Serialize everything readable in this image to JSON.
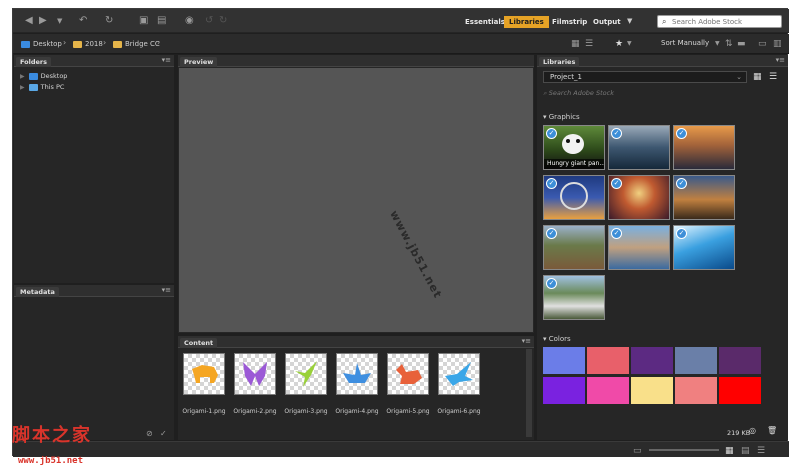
{
  "toolbar": {
    "workspaces": [
      "Essentials",
      "Libraries",
      "Filmstrip",
      "Output"
    ],
    "active_workspace": "Libraries",
    "search_placeholder": "Search Adobe Stock"
  },
  "path": {
    "crumbs": [
      "Desktop",
      "2018",
      "Bridge CC"
    ],
    "sort_label": "Sort Manually"
  },
  "folders_panel": {
    "title": "Folders",
    "items": [
      "Desktop",
      "This PC"
    ]
  },
  "metadata_panel": {
    "title": "Metadata"
  },
  "preview_panel": {
    "title": "Preview"
  },
  "content_panel": {
    "title": "Content",
    "items": [
      {
        "name": "Origami-1.png",
        "color": "#f5a623"
      },
      {
        "name": "Origami-2.png",
        "color": "#9b59d6"
      },
      {
        "name": "Origami-3.png",
        "color": "#9ad13a"
      },
      {
        "name": "Origami-4.png",
        "color": "#3f8fe0"
      },
      {
        "name": "Origami-5.png",
        "color": "#e8613a"
      },
      {
        "name": "Origami-6.png",
        "color": "#3aa6e8"
      }
    ]
  },
  "libraries_panel": {
    "title": "Libraries",
    "selected_library": "Project_1",
    "search_placeholder": "Search Adobe Stock",
    "graphics_label": "Graphics",
    "first_graphic_caption": "Hungry giant pan...",
    "colors_label": "Colors",
    "swatches": [
      "#6b7de8",
      "#e8606a",
      "#5c2a82",
      "#6a7fa8",
      "#5a2a6a",
      "#7a22e0",
      "#f04aa8",
      "#f9e08a",
      "#f08080",
      "#ff0000"
    ],
    "size_label": "219 KB"
  },
  "watermark": "www.jb51.net",
  "site": {
    "logo_text": "脚本之家",
    "url": "www.jb51.net"
  }
}
